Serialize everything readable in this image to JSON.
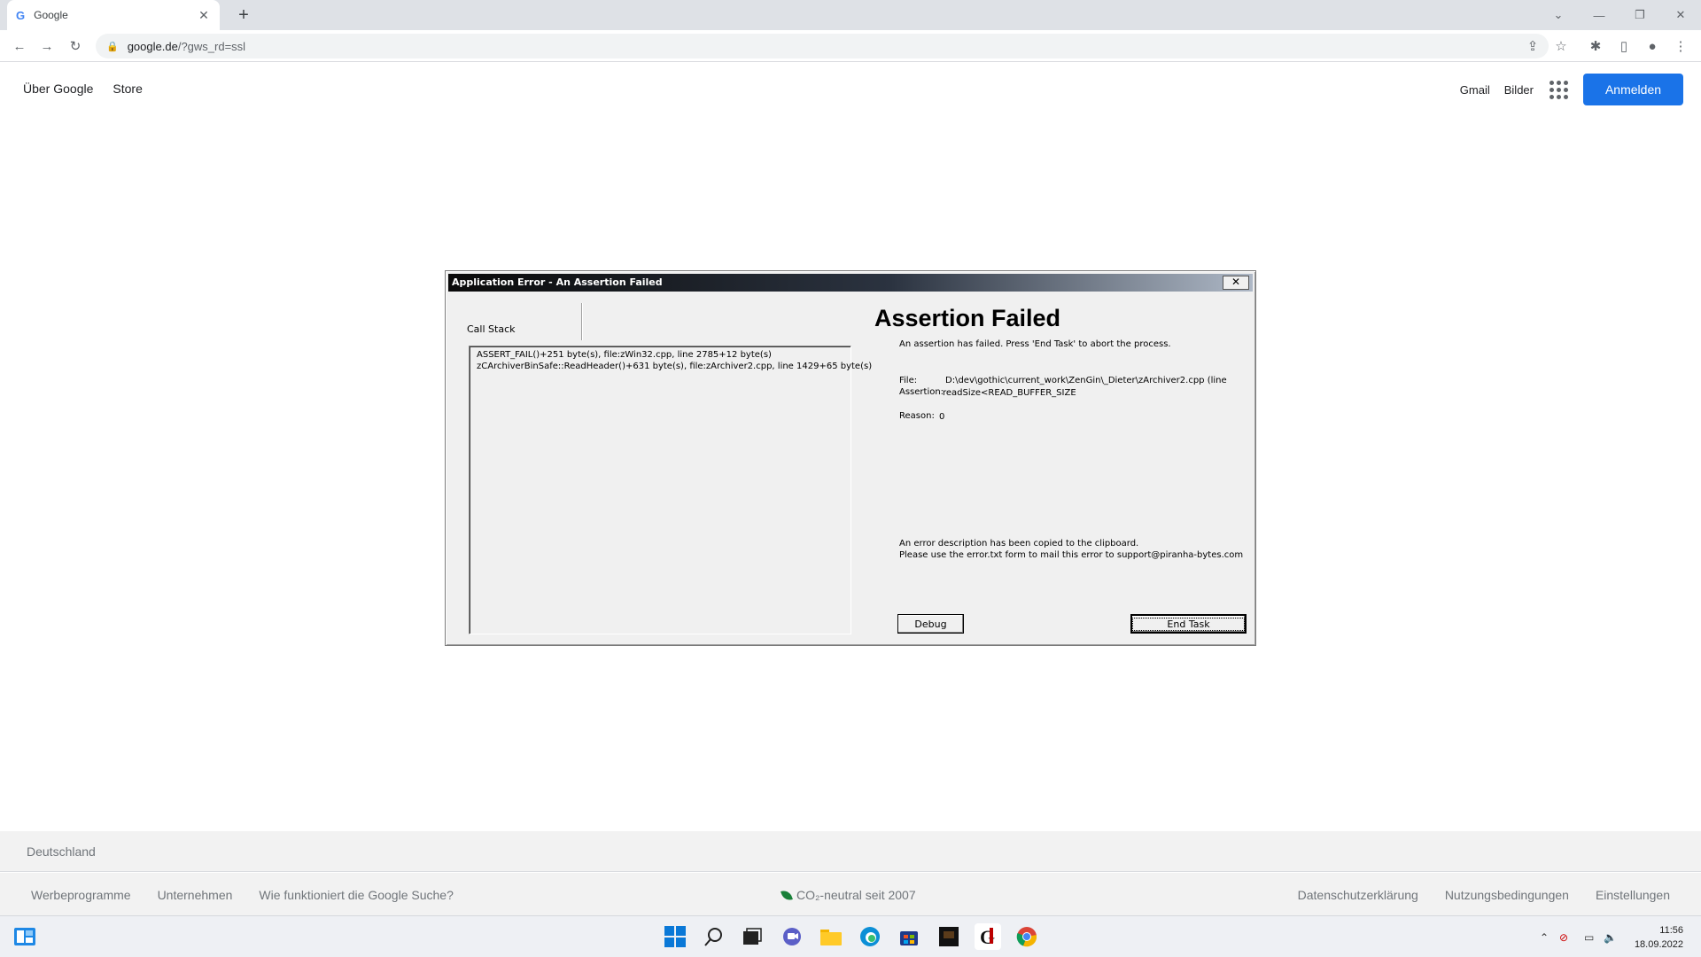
{
  "browser": {
    "tab_title": "Google",
    "tab_favicon": "G",
    "new_tab": "+",
    "url_host": "google.de",
    "url_path": "/?gws_rd=ssl"
  },
  "google": {
    "header_left": [
      "Über Google",
      "Store"
    ],
    "gmail": "Gmail",
    "images": "Bilder",
    "signin": "Anmelden",
    "footer_country": "Deutschland",
    "footer_left": [
      "Werbeprogramme",
      "Unternehmen",
      "Wie funktioniert die Google Suche?"
    ],
    "footer_center": "CO₂-neutral seit 2007",
    "footer_right": [
      "Datenschutzerklärung",
      "Nutzungsbedingungen",
      "Einstellungen"
    ]
  },
  "dialog": {
    "title": "Application Error - An Assertion Failed",
    "close": "✕",
    "call_stack_label": "Call Stack",
    "call_stack": [
      "ASSERT_FAIL()+251 byte(s), file:zWin32.cpp, line 2785+12 byte(s)",
      "zCArchiverBinSafe::ReadHeader()+631 byte(s), file:zArchiver2.cpp, line 1429+65 byte(s)"
    ],
    "heading": "Assertion Failed",
    "message": "An assertion has failed. Press 'End Task' to abort the process.",
    "file_label": "File:",
    "file_value": "D:\\dev\\gothic\\current_work\\ZenGin\\_Dieter\\zArchiver2.cpp (line",
    "assertion_label": "Assertion:",
    "assertion_value": "readSize<READ_BUFFER_SIZE",
    "reason_label": "Reason:",
    "reason_value": "0",
    "clipboard_line1": "An error description has been copied to the clipboard.",
    "clipboard_line2": "Please use the error.txt form to mail this error to support@piranha-bytes.com",
    "debug_button": "Debug",
    "end_task_button": "End Task"
  },
  "taskbar": {
    "time": "11:56",
    "date": "18.09.2022"
  },
  "colors": {
    "accent": "#1a73e8",
    "footer_bg": "#f2f2f2",
    "dialog_bg": "#f0f0f0"
  }
}
